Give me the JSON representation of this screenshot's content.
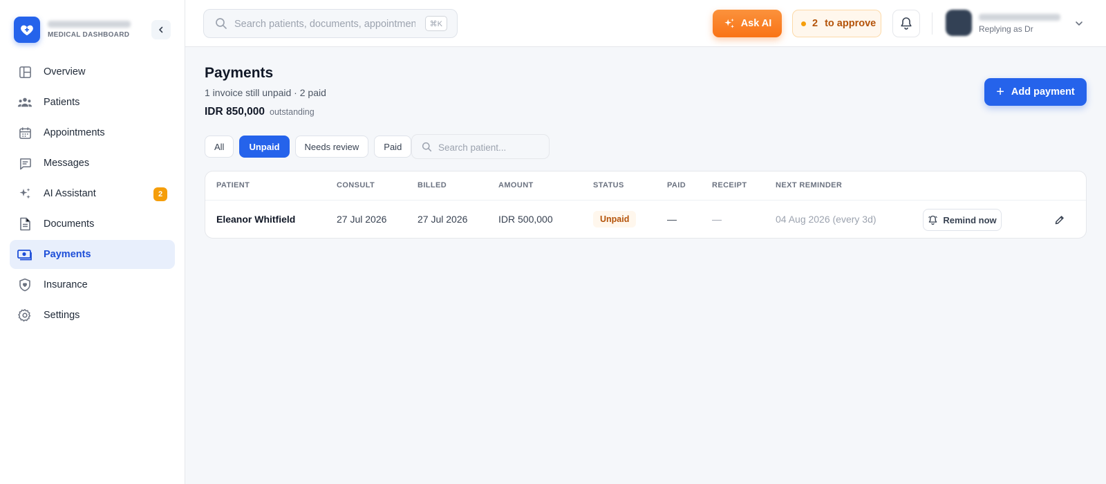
{
  "brand": {
    "subtitle": "MEDICAL DASHBOARD"
  },
  "sidebar": {
    "items": [
      {
        "label": "Overview",
        "icon": "layout-icon"
      },
      {
        "label": "Patients",
        "icon": "users-icon"
      },
      {
        "label": "Appointments",
        "icon": "calendar-icon"
      },
      {
        "label": "Messages",
        "icon": "message-icon"
      },
      {
        "label": "AI Assistant",
        "icon": "sparkle-icon",
        "badge": "2"
      },
      {
        "label": "Documents",
        "icon": "document-icon"
      },
      {
        "label": "Payments",
        "icon": "banknote-icon",
        "active": true
      },
      {
        "label": "Insurance",
        "icon": "shield-heart-icon"
      },
      {
        "label": "Settings",
        "icon": "gear-icon"
      }
    ]
  },
  "topbar": {
    "search_placeholder": "Search patients, documents, appointments...",
    "search_shortcut": "⌘K",
    "ask_ai_label": "Ask AI",
    "approve_count": "2",
    "approve_label": "to approve",
    "profile_subtitle": "Replying as Dr"
  },
  "page": {
    "title": "Payments",
    "subtitle": "1 invoice still unpaid · 2 paid",
    "outstanding_amount": "IDR 850,000",
    "outstanding_label": "outstanding",
    "add_payment_label": "Add payment"
  },
  "filters": {
    "chips": [
      "All",
      "Unpaid",
      "Needs review",
      "Paid"
    ],
    "active": "Unpaid",
    "search_placeholder": "Search patient..."
  },
  "table": {
    "columns": [
      "PATIENT",
      "CONSULT",
      "BILLED",
      "AMOUNT",
      "STATUS",
      "PAID",
      "RECEIPT",
      "NEXT REMINDER"
    ],
    "rows": [
      {
        "patient": "Eleanor Whitfield",
        "consult": "27 Jul 2026",
        "billed": "27 Jul 2026",
        "amount": "IDR 500,000",
        "status": "Unpaid",
        "paid": "—",
        "receipt": "—",
        "next_reminder": "04 Aug 2026 (every 3d)",
        "remind_label": "Remind now"
      }
    ]
  },
  "colors": {
    "primary": "#2563eb",
    "accent_orange": "#f97316",
    "warning": "#f59e0b",
    "unpaid_text": "#b45309"
  }
}
